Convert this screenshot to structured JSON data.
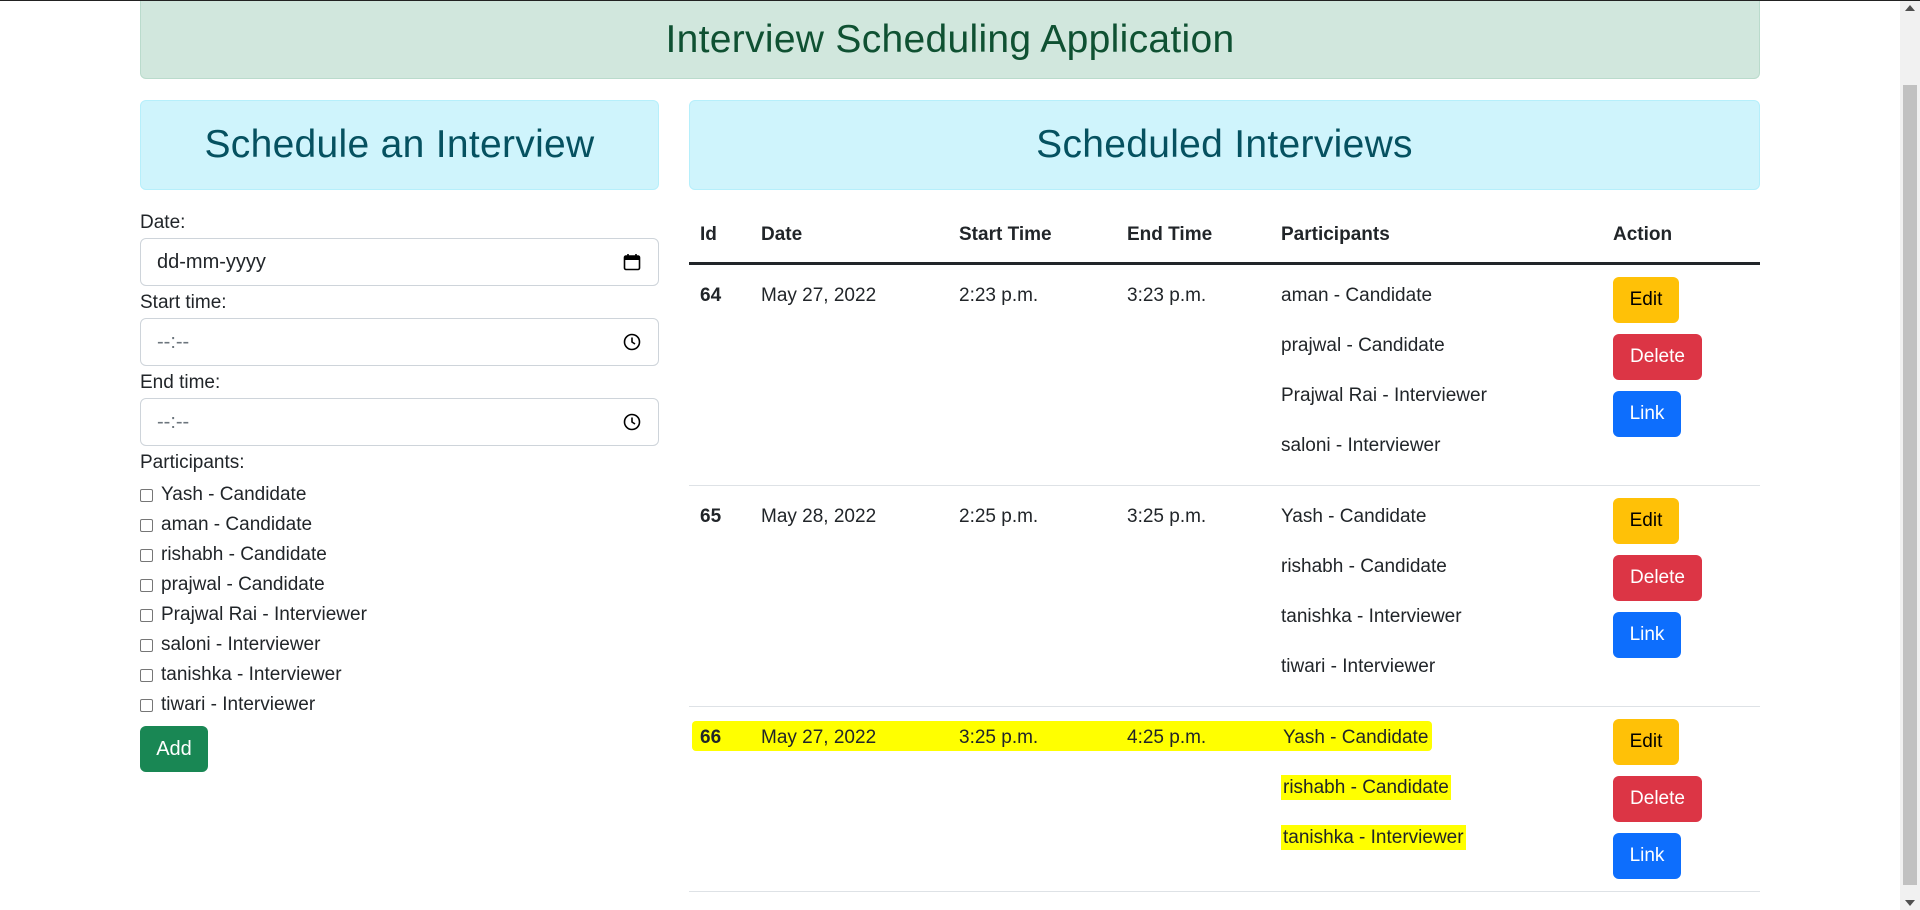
{
  "app": {
    "title": "Interview Scheduling Application"
  },
  "left_panel": {
    "title": "Schedule an Interview",
    "date_label": "Date:",
    "date_value": "dd-mm-yyyy",
    "start_label": "Start time:",
    "start_value": "--:--",
    "end_label": "End time:",
    "end_value": "--:--",
    "participants_label": "Participants:",
    "participants": [
      "Yash - Candidate",
      "aman - Candidate",
      "rishabh - Candidate",
      "prajwal - Candidate",
      "Prajwal Rai - Interviewer",
      "saloni - Interviewer",
      "tanishka - Interviewer",
      "tiwari - Interviewer"
    ],
    "add_button": "Add"
  },
  "right_panel": {
    "title": "Scheduled Interviews",
    "headers": [
      "Id",
      "Date",
      "Start Time",
      "End Time",
      "Participants",
      "Action"
    ],
    "actions": {
      "edit": "Edit",
      "delete": "Delete",
      "link": "Link"
    },
    "rows": [
      {
        "id": "64",
        "date": "May 27, 2022",
        "start": "2:23 p.m.",
        "end": "3:23 p.m.",
        "participants": [
          "aman - Candidate",
          "prajwal - Candidate",
          "Prajwal Rai - Interviewer",
          "saloni - Interviewer"
        ]
      },
      {
        "id": "65",
        "date": "May 28, 2022",
        "start": "2:25 p.m.",
        "end": "3:25 p.m.",
        "participants": [
          "Yash - Candidate",
          "rishabh - Candidate",
          "tanishka - Interviewer",
          "tiwari - Interviewer"
        ]
      },
      {
        "id": "66",
        "date": "May 27, 2022",
        "start": "3:25 p.m.",
        "end": "4:25 p.m.",
        "participants": [
          "Yash - Candidate",
          "rishabh - Candidate",
          "tanishka - Interviewer"
        ],
        "highlighted": true
      }
    ]
  },
  "colors": {
    "header_bg": "#d1e7dd",
    "header_text": "#0f5132",
    "panel_bg": "#cff4fc",
    "panel_text": "#055160",
    "add_button": "#198754",
    "edit_button": "#ffc107",
    "delete_button": "#dc3545",
    "link_button": "#0d6efd",
    "highlight": "#ffff00"
  }
}
